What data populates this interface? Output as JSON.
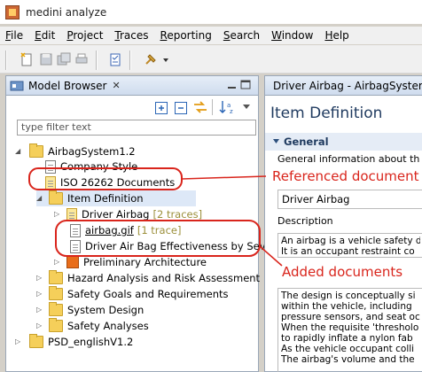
{
  "window": {
    "title": "medini analyze"
  },
  "menu": [
    {
      "label": "File",
      "mnemonic": "F",
      "rest": "ile"
    },
    {
      "label": "Edit",
      "mnemonic": "E",
      "rest": "dit"
    },
    {
      "label": "Project",
      "mnemonic": "P",
      "rest": "roject"
    },
    {
      "label": "Traces",
      "mnemonic": "T",
      "rest": "races"
    },
    {
      "label": "Reporting",
      "mnemonic": "R",
      "rest": "eporting"
    },
    {
      "label": "Search",
      "mnemonic": "S",
      "rest": "earch"
    },
    {
      "label": "Window",
      "mnemonic": "W",
      "rest": "indow"
    },
    {
      "label": "Help",
      "mnemonic": "H",
      "rest": "elp"
    }
  ],
  "model_browser": {
    "tab_label": "Model Browser",
    "close_glyph": "✕",
    "filter_placeholder": "type filter text",
    "tree": [
      {
        "label": "AirbagSystem1.2",
        "icon": "project-folder-icon"
      },
      {
        "label": "Company Style",
        "icon": "document-icon"
      },
      {
        "label": "ISO 26262 Documents",
        "icon": "document-link-icon"
      },
      {
        "label": "Item Definition",
        "icon": "folder-icon"
      },
      {
        "label": "Driver Airbag",
        "trace": "[2 traces]",
        "icon": "requirement-doc-icon"
      },
      {
        "label": "airbag.gif",
        "trace": "[1 trace]",
        "icon": "document-icon"
      },
      {
        "label": "Driver Air Bag Effectiveness by Severit",
        "icon": "document-icon"
      },
      {
        "label": "Preliminary Architecture",
        "icon": "architecture-icon"
      },
      {
        "label": "Hazard Analysis and Risk Assessment",
        "icon": "folder-icon"
      },
      {
        "label": "Safety Goals and Requirements",
        "icon": "folder-icon"
      },
      {
        "label": "System Design",
        "icon": "folder-icon"
      },
      {
        "label": "Safety Analyses",
        "icon": "folder-icon"
      },
      {
        "label": "PSD_englishV1.2",
        "icon": "project-folder-icon"
      }
    ]
  },
  "editor": {
    "tab_label": "Driver Airbag - AirbagSystem",
    "heading": "Item Definition",
    "section": "General",
    "general_info": "General information about th",
    "name_value": "Driver Airbag",
    "description_label": "Description",
    "desc_lines_1": [
      "An airbag is a vehicle safety d",
      "It is an occupant restraint co"
    ],
    "desc_lines_2": [
      "The design is conceptually si",
      "within the vehicle, including",
      "pressure sensors, and seat oc",
      "When the requisite 'thresholo",
      "to rapidly inflate a nylon fab",
      "As the vehicle occupant colli",
      "The airbag's volume and the"
    ]
  },
  "annotations": {
    "referenced": "Referenced document",
    "added": "Added documents",
    "color": "#d9251c"
  }
}
